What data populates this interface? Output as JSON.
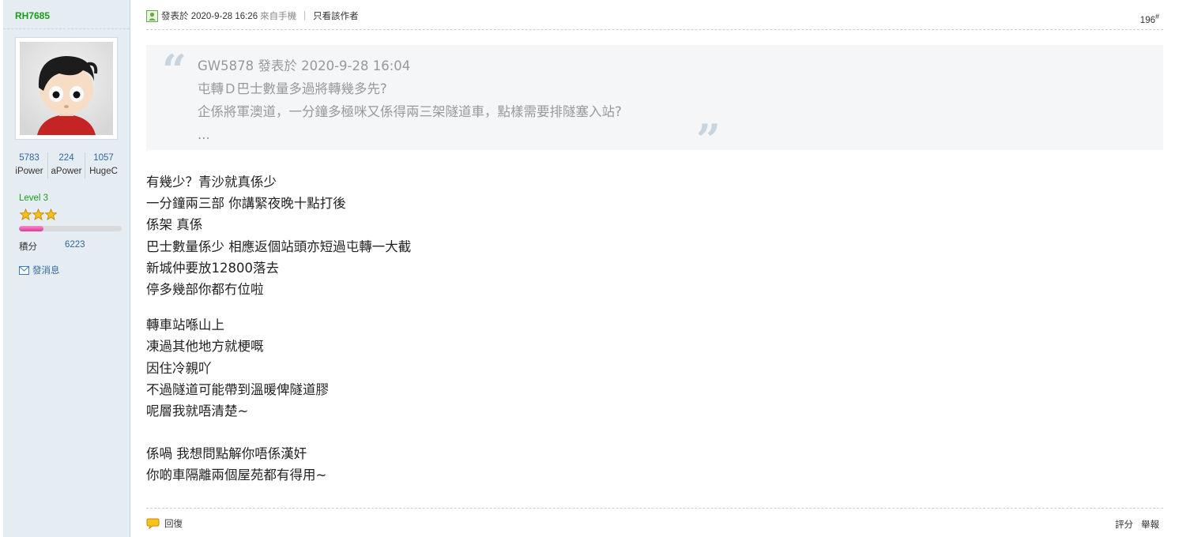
{
  "user": {
    "name": "RH7685",
    "stats": [
      {
        "value": "5783",
        "label": "iPower"
      },
      {
        "value": "224",
        "label": "aPower"
      },
      {
        "value": "1057",
        "label": "HugeC"
      }
    ],
    "level": "Level 3",
    "star_count": 3,
    "level_progress": 0.24,
    "credits_label": "積分",
    "credits_value": "6223",
    "pm_label": "發消息",
    "icons": {
      "pm": "envelope-icon",
      "star": "star-icon",
      "avatar": "avatar-image"
    }
  },
  "post": {
    "posted_label": "發表於 2020-9-28 16:26",
    "from_mobile": "來自手機",
    "separator": "|",
    "only_author": "只看該作者",
    "floor_num": "196",
    "floor_mark": "#",
    "quote": {
      "author_line": "GW5878 發表於 2020-9-28 16:04",
      "lines": [
        "屯轉Ｄ巴士數量多過將轉幾多先?",
        "企係將軍澳道，一分鐘多極咪又係得兩三架隧道車，點樣需要排隧塞入站?",
        "..."
      ]
    },
    "body": [
      "有幾少？青沙就真係少",
      "一分鐘兩三部 你講緊夜晚十點打後",
      "係架 真係",
      "巴士數量係少 相應返個站頭亦短過屯轉一大截",
      "新城仲要放12800落去",
      "停多幾部你都冇位啦"
    ],
    "body2": [
      "轉車站喺山上",
      "凍過其他地方就梗嘅",
      "因住冷親吖",
      "不過隧道可能帶到溫暖俾隧道膠",
      "呢層我就唔清楚~"
    ],
    "body3": [
      "係喎 我想問點解你唔係漢奸",
      "你啲車隔離兩個屋苑都有得用~"
    ],
    "reply_label": "回復",
    "rate_label": "評分",
    "report_label": "舉報"
  },
  "colors": {
    "username": "#1a9e1a",
    "link": "#336699",
    "sidebar_bg": "#e5edf2",
    "progress": "#e0389a",
    "star": "#f5b800"
  }
}
